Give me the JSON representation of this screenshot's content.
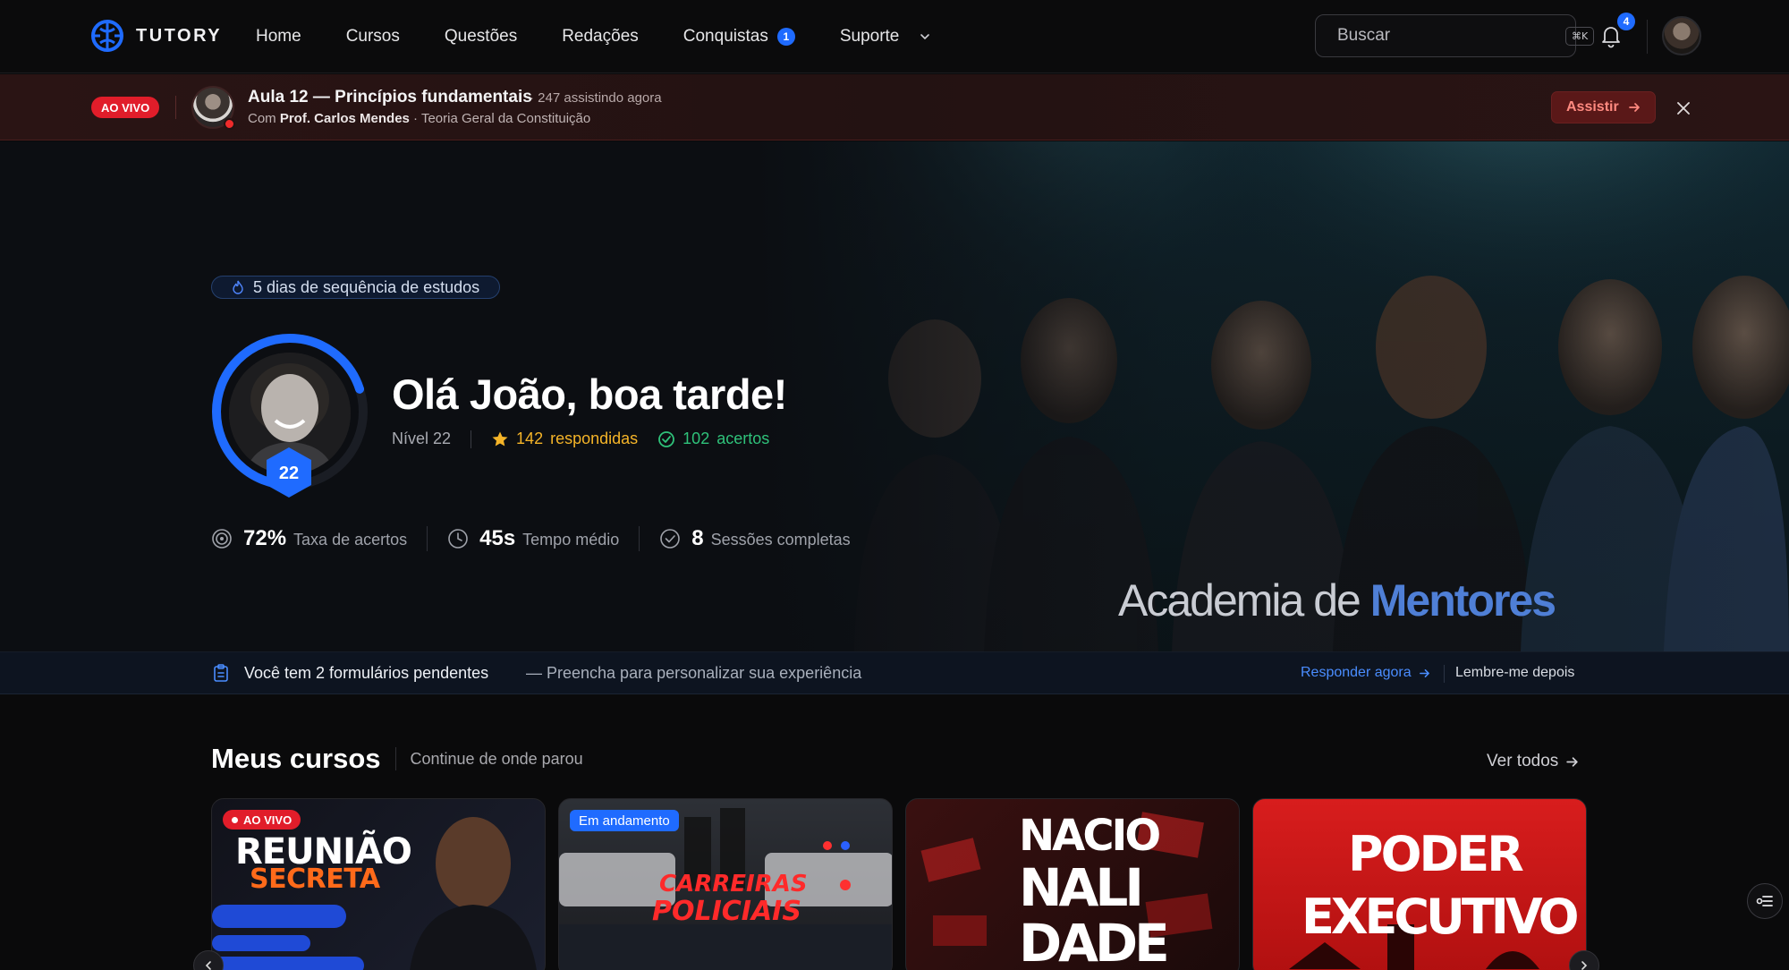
{
  "nav": {
    "brand": "TUTORY",
    "links": [
      {
        "label": "Home"
      },
      {
        "label": "Cursos"
      },
      {
        "label": "Questões"
      },
      {
        "label": "Redações"
      },
      {
        "label": "Conquistas",
        "badge": "1"
      },
      {
        "label": "Suporte"
      }
    ],
    "search_placeholder": "Buscar",
    "search_shortcut": "⌘K",
    "notifications": "4",
    "accent": "#1f6bff"
  },
  "live": {
    "pill": "AO VIVO",
    "title": "Aula 12 — Princípios fundamentais",
    "watching": "· 247 assistindo agora",
    "sub_prefix": "Com ",
    "teacher": "Prof. Carlos Mendes",
    "sub_suffix": " · Teoria Geral da Constituição",
    "watch_button": "Assistir",
    "live_color": "#e11d2a"
  },
  "hero": {
    "streak": "5 dias de sequência de estudos",
    "greeting": "Olá João, boa tarde!",
    "level_badge": "22",
    "level_text": "Nível 22",
    "answered_count": "142",
    "answered_label": "respondidas",
    "correct_count": "102",
    "correct_label": "acertos",
    "level_progress_pct": 70,
    "stats": [
      {
        "value": "72%",
        "label": "Taxa de acertos",
        "icon": "target-icon"
      },
      {
        "value": "45s",
        "label": "Tempo médio",
        "icon": "clock-icon"
      },
      {
        "value": "8",
        "label": "Sessões completas",
        "icon": "check-circle-icon"
      }
    ],
    "banner_part1": "Academia de ",
    "banner_part2": "Mentores"
  },
  "pending": {
    "title": "Você tem 2 formulários pendentes",
    "subtitle": "— Preencha para personalizar sua experiência",
    "answer": "Responder agora",
    "later": "Lembre-me depois"
  },
  "courses": {
    "title": "Meus cursos",
    "subtitle": "Continue de onde parou",
    "see_all": "Ver todos",
    "cards": [
      {
        "tag": "AO VIVO",
        "line1": "REUNIÃO",
        "line2": "SECRETA"
      },
      {
        "tag": "Em andamento",
        "line1": "CARREIRAS",
        "line2": "POLICIAIS"
      },
      {
        "tag": "",
        "line1": "NACIO",
        "line2": "NALI",
        "line3": "DADE"
      },
      {
        "tag": "",
        "line1": "PODER",
        "line2": "EXECUTIVO"
      }
    ]
  }
}
